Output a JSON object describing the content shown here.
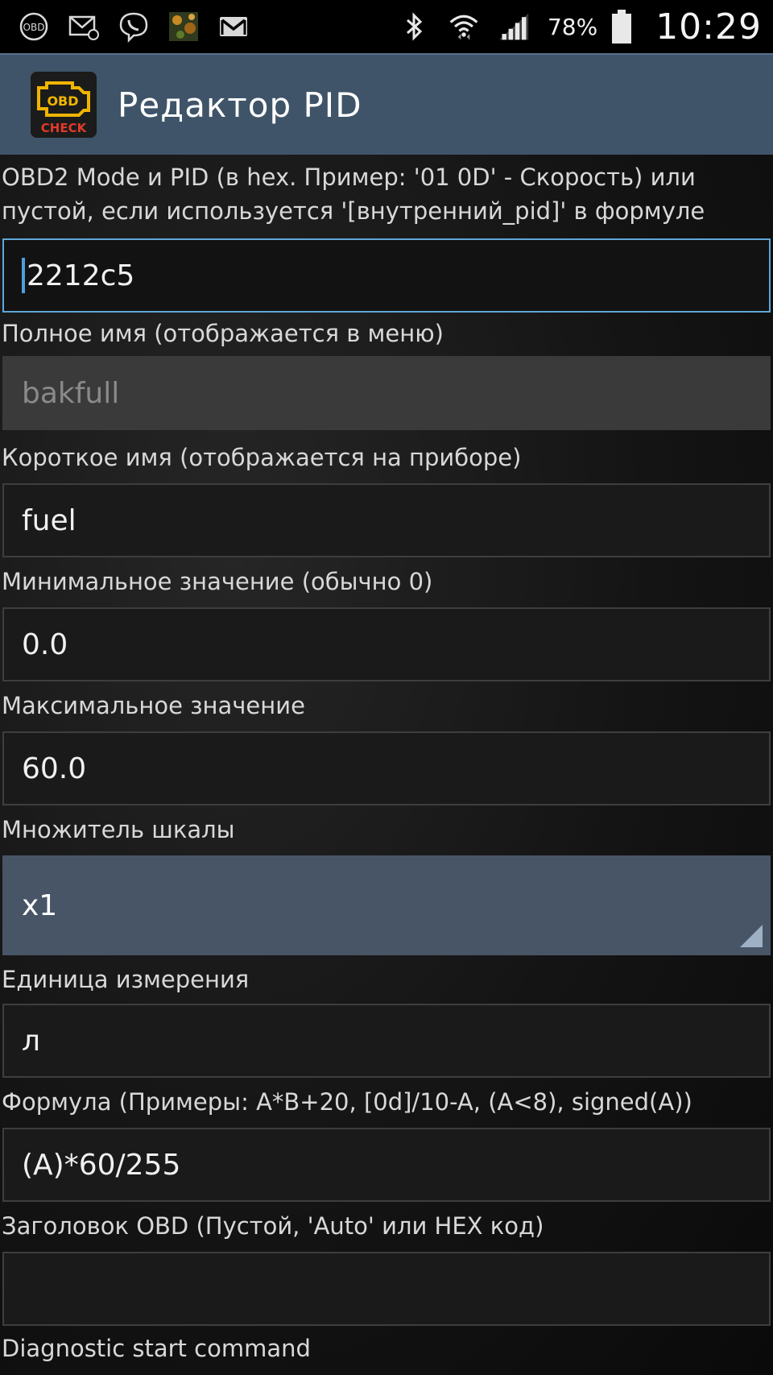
{
  "status_bar": {
    "left_icons": [
      "obd-icon",
      "email-icon",
      "viber-icon",
      "photo-thumbnail-icon",
      "gmail-icon"
    ],
    "right_icons": [
      "bluetooth-icon",
      "wifi-icon",
      "signal-icon",
      "battery-icon"
    ],
    "obd_icon_text": "OBD",
    "battery_percent": "78%",
    "time": "10:29"
  },
  "action_bar": {
    "app_icon_top_text": "OBD",
    "app_icon_bottom_text": "CHECK",
    "title": "Редактор PID"
  },
  "form": {
    "pid_label_line1": "OBD2 Mode и PID (в hex. Пример: '01 0D' - Скорость) или",
    "pid_label_line2": "пустой, если используется '[внутренний_pid]' в формуле",
    "pid_value": "2212c5",
    "full_name_label": "Полное имя (отображается в меню)",
    "full_name_value": "bakfull",
    "short_name_label": "Короткое имя (отображается на приборе)",
    "short_name_value": "fuel",
    "min_label": "Минимальное значение (обычно 0)",
    "min_value": "0.0",
    "max_label": "Максимальное значение",
    "max_value": "60.0",
    "scale_label": "Множитель шкалы",
    "scale_value": "x1",
    "unit_label": "Единица измерения",
    "unit_value": "л",
    "formula_label": "Формула (Примеры: A*B+20, [0d]/10-A, (A<8), signed(A))",
    "formula_value": "(A)*60/255",
    "header_label": "Заголовок OBD (Пустой, 'Auto' или HEX код)",
    "header_value": "",
    "diag_label": "Diagnostic start command"
  },
  "colors": {
    "action_bar": "#3f5468",
    "focus_border": "#5fa7d9",
    "spinner_bg": "#485566"
  }
}
